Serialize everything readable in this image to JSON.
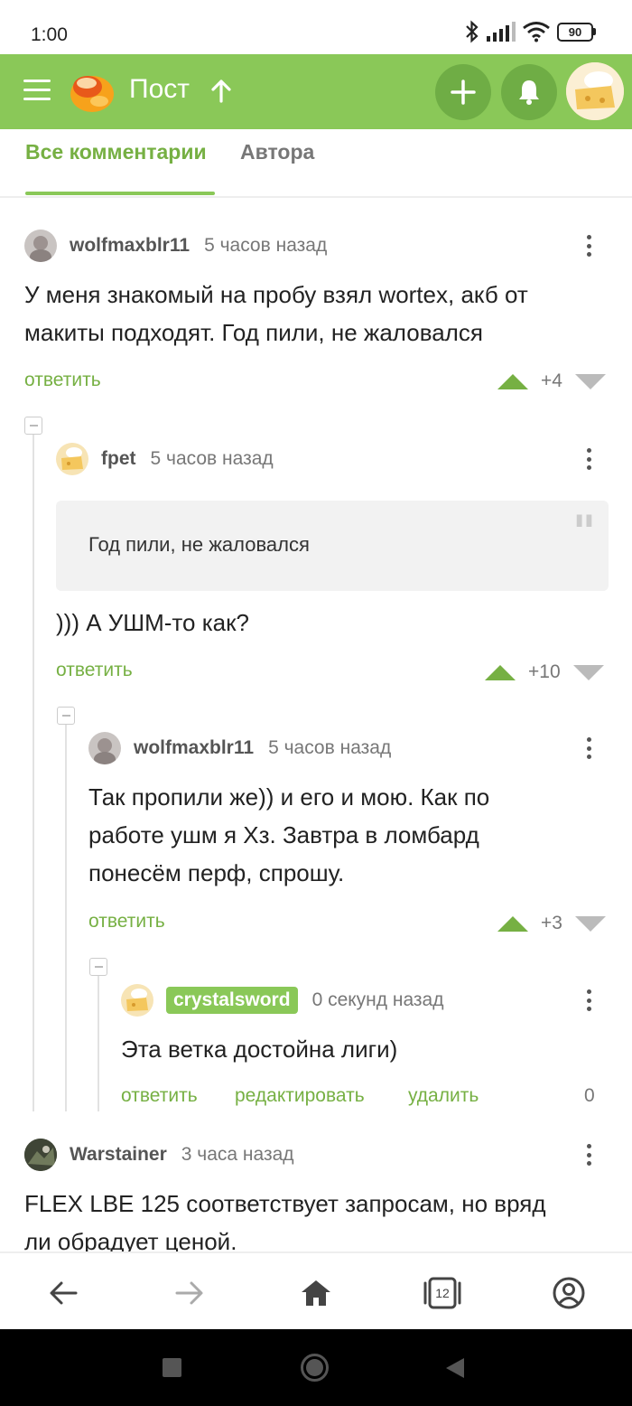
{
  "status_bar": {
    "time": "1:00",
    "battery": "90"
  },
  "header": {
    "title": "Пост"
  },
  "tabs": [
    {
      "label": "Все комментарии",
      "active": true
    },
    {
      "label": "Автора",
      "active": false
    }
  ],
  "comments": [
    {
      "author": "wolfmaxblr11",
      "time": "5 часов назад",
      "text_lines": [
        "У меня знакомый на пробу взял wortex, акб от",
        "макиты подходят. Год пили, не жаловался"
      ],
      "reply": "ответить",
      "score": "+4"
    },
    {
      "author": "fpet",
      "time": "5 часов назад",
      "quote": "Год пили, не жаловался",
      "text_lines": [
        "))) А УШМ-то как?"
      ],
      "reply": "ответить",
      "score": "+10"
    },
    {
      "author": "wolfmaxblr11",
      "time": "5 часов назад",
      "text_lines": [
        "Так пропили же)) и его и мою. Как по",
        "работе ушм я Хз. Завтра в ломбард",
        "понесём перф, спрошу."
      ],
      "reply": "ответить",
      "score": "+3"
    },
    {
      "author": "crystalsword",
      "time": "0 секунд назад",
      "text_lines": [
        "Эта ветка достойна лиги)"
      ],
      "reply": "ответить",
      "edit": "редактировать",
      "delete": "удалить",
      "score": "0"
    },
    {
      "author": "Warstainer",
      "time": "3 часа назад",
      "text_lines": [
        "FLEX LBE 125 соответствует запросам, но вряд",
        "ли обрадует ценой."
      ]
    }
  ],
  "bottom_nav": {
    "tabs_count": "12"
  },
  "colors": {
    "accent": "#8ac858",
    "accent_dark": "#76b043",
    "header_button": "#6fad45"
  }
}
